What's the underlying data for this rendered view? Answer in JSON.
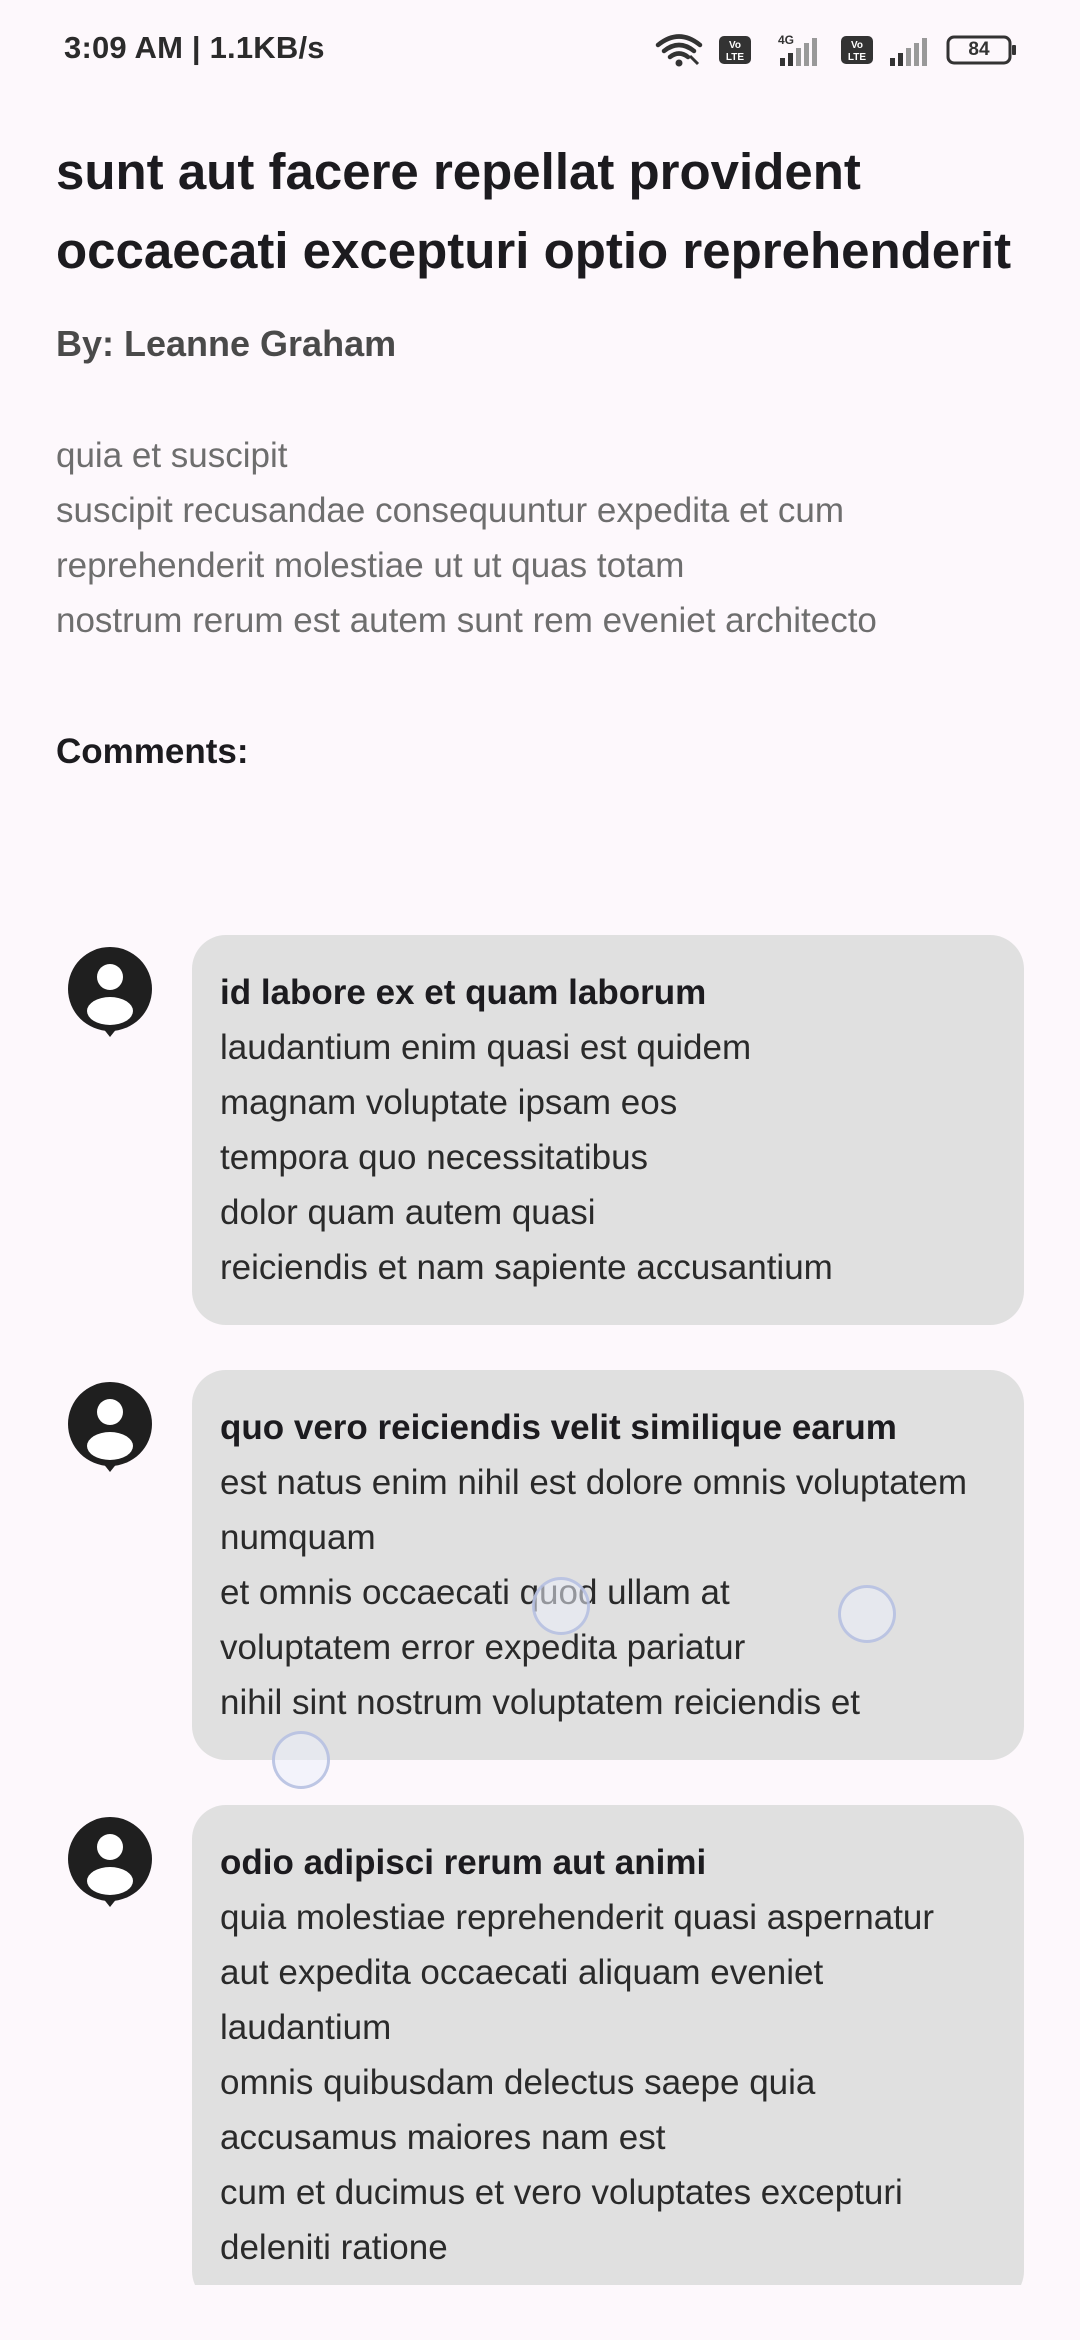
{
  "status_bar": {
    "time_speed": "3:09 AM | 1.1KB/s",
    "network_label": "4G",
    "volte_label": "Vo\nLTE",
    "battery": "84"
  },
  "post": {
    "title": "sunt aut facere repellat provident occaecati excepturi optio reprehenderit",
    "author": "By: Leanne Graham",
    "body": "quia et suscipit\nsuscipit recusandae consequuntur expedita et cum\nreprehenderit molestiae ut ut quas totam\nnostrum rerum est autem sunt rem eveniet architecto"
  },
  "comments_heading": "Comments:",
  "comments": [
    {
      "name": "id labore ex et quam laborum",
      "body": "laudantium enim quasi est quidem\nmagnam voluptate ipsam eos\ntempora quo necessitatibus\ndolor quam autem quasi\nreiciendis et nam sapiente accusantium"
    },
    {
      "name": "quo vero reiciendis velit similique earum",
      "body": "est natus enim nihil est dolore omnis voluptatem numquam\net omnis occaecati quod ullam at\nvoluptatem error expedita pariatur\nnihil sint nostrum voluptatem reiciendis et"
    },
    {
      "name": "odio adipisci rerum aut animi",
      "body": "quia molestiae reprehenderit quasi aspernatur\naut expedita occaecati aliquam eveniet laudantium\nomnis quibusdam delectus saepe quia accusamus maiores nam est\ncum et ducimus et vero voluptates excepturi deleniti ratione"
    }
  ],
  "colors": {
    "background": "#fdf8fc",
    "bubble": "#e0e0e0",
    "text_primary": "#1c1b1f",
    "text_secondary": "#6e6e6e"
  }
}
